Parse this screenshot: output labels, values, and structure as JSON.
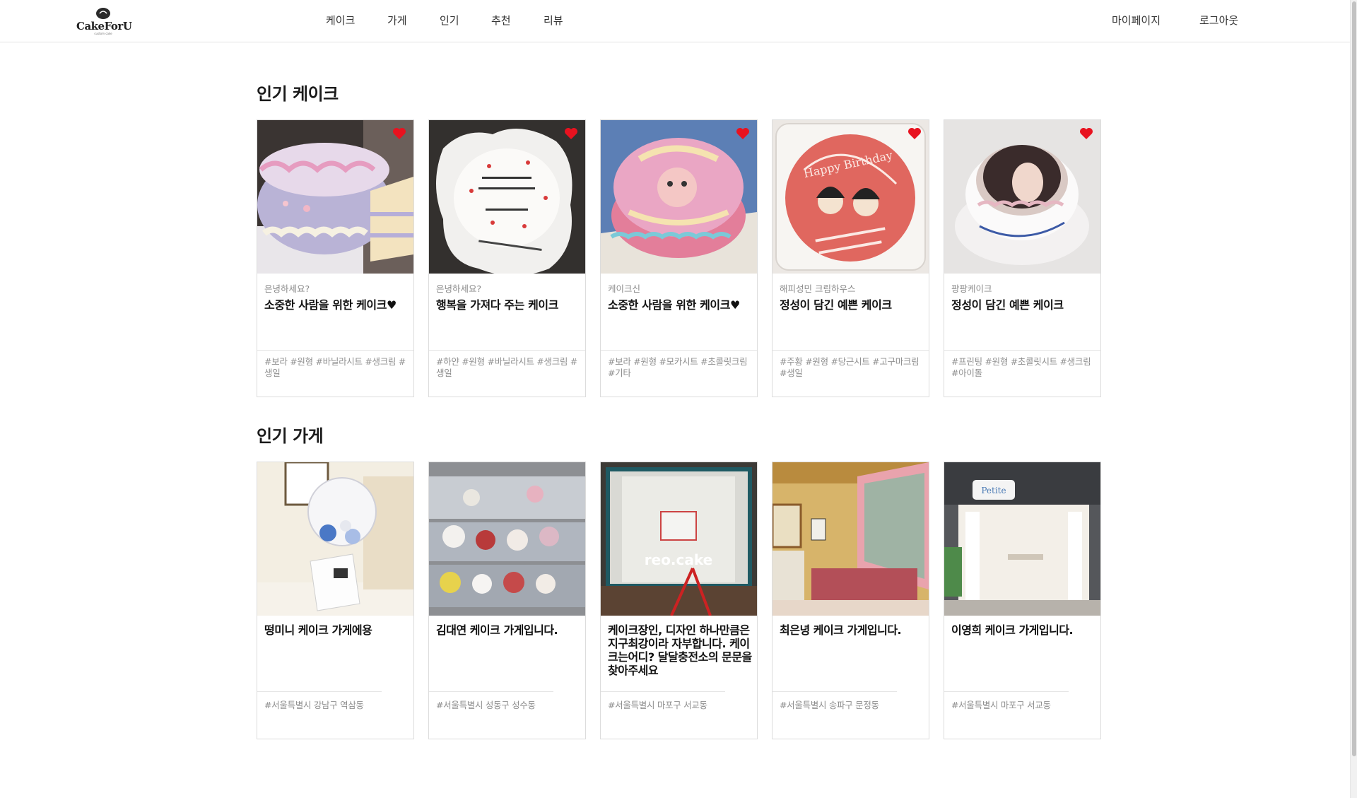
{
  "header": {
    "logo_text": "CakeForU",
    "logo_sub": "custom cake",
    "nav": [
      "케이크",
      "가게",
      "인기",
      "추천",
      "리뷰"
    ],
    "mypage": "마이페이지",
    "logout": "로그아웃"
  },
  "colors": {
    "heart": "#e8121f",
    "border": "#dcdcdc",
    "muted_text": "#8a8a8a"
  },
  "popular_cakes": {
    "title": "인기 케이크",
    "items": [
      {
        "store": "은녕하세요?",
        "title": "소중한 사람을 위한 케이크♥",
        "tags": "#보라 #원형 #바닐라시트 #생크림 #생일",
        "liked": true
      },
      {
        "store": "은녕하세요?",
        "title": "행복을 가져다 주는 케이크",
        "tags": "#하얀 #원형 #바닐라시트 #생크림 #생일",
        "liked": true
      },
      {
        "store": "케이크신",
        "title": "소중한 사람을 위한 케이크♥",
        "tags": "#보라 #원형 #모카시트 #초콜릿크림 #기타",
        "liked": true
      },
      {
        "store": "해피성민 크림하우스",
        "title": "정성이 담긴 예쁜 케이크",
        "tags": "#주황 #원형 #당근시트 #고구마크림 #생일",
        "liked": true
      },
      {
        "store": "팡팡케이크",
        "title": "정성이 담긴 예쁜 케이크",
        "tags": "#프린팅 #원형 #초콜릿시트 #생크림 #아이돌",
        "liked": true
      }
    ]
  },
  "popular_shops": {
    "title": "인기 가게",
    "items": [
      {
        "title": "떵미니 케이크 가게에용",
        "address": "#서울특별시 강남구 역삼동"
      },
      {
        "title": "김대연 케이크 가게입니다.",
        "address": "#서울특별시 성동구 성수동"
      },
      {
        "title": "케이크장인, 디자인 하나만큼은 지구최강이라 자부합니다. 케이크는어디? 달달충전소의 문문을 찾아주세요",
        "address": "#서울특별시 마포구 서교동"
      },
      {
        "title": "최은녕 케이크 가게입니다.",
        "address": "#서울특별시 송파구 문정동"
      },
      {
        "title": "이영희 케이크 가게입니다.",
        "address": "#서울특별시 마포구 서교동"
      }
    ]
  },
  "image_text": {
    "cake4_text": "Happy Birthday",
    "shop3_sign": "reo.cake",
    "shop5_sign": "Petite"
  }
}
